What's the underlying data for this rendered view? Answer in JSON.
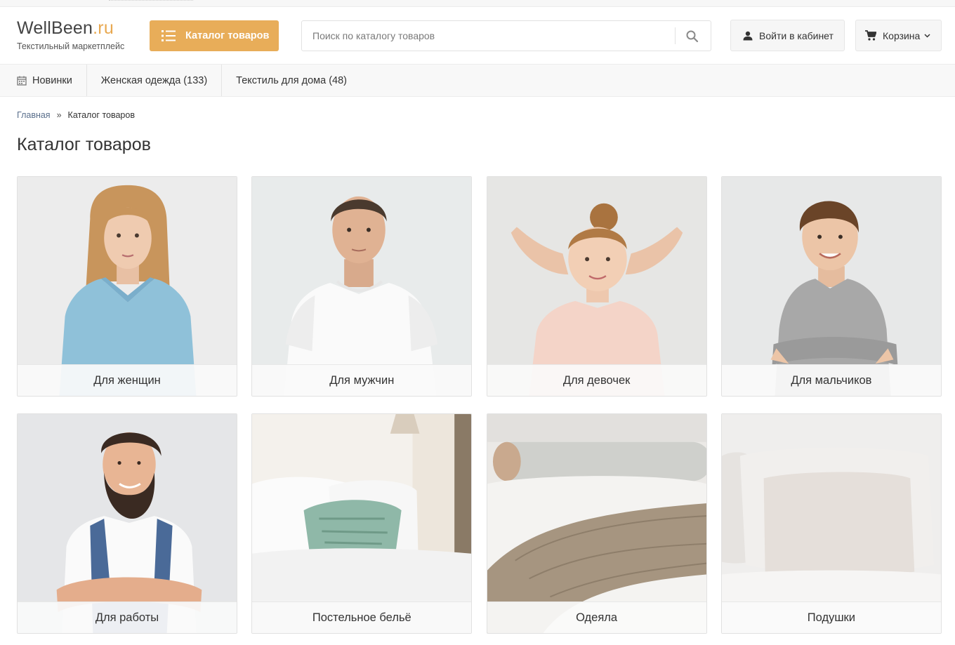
{
  "header": {
    "logo_main": "WellBeen",
    "logo_domain": ".ru",
    "logo_sub": "Текстильный маркетплейс",
    "catalog_button": "Каталог товаров",
    "search_placeholder": "Поиск по каталогу товаров",
    "login_button": "Войти в кабинет",
    "cart_button": "Корзина"
  },
  "menu": {
    "items": [
      {
        "label": "Новинки",
        "icon": "calendar-icon"
      },
      {
        "label": "Женская одежда (133)"
      },
      {
        "label": "Текстиль для дома (48)"
      }
    ]
  },
  "breadcrumb": {
    "home": "Главная",
    "separator": "»",
    "current": "Каталог товаров"
  },
  "page_title": "Каталог товаров",
  "categories": [
    {
      "label": "Для женщин"
    },
    {
      "label": "Для мужчин"
    },
    {
      "label": "Для девочек"
    },
    {
      "label": "Для мальчиков"
    },
    {
      "label": "Для работы"
    },
    {
      "label": "Постельное бельё"
    },
    {
      "label": "Одеяла"
    },
    {
      "label": "Подушки"
    }
  ],
  "colors": {
    "accent": "#e8ad59",
    "link": "#5a6f8c"
  }
}
